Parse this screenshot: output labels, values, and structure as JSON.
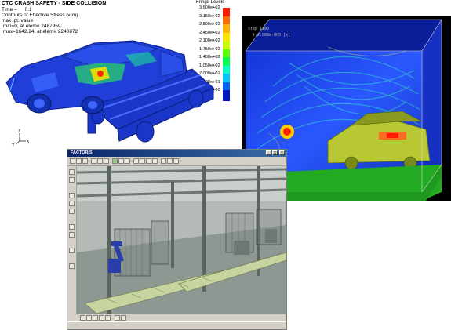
{
  "crash": {
    "title": "CTC CRASH SAFETY - SIDE COLLISION",
    "time_label": "Time =",
    "time_value": "0.1",
    "contour_label": "Contours of Effective Stress (v-m)",
    "max_ipt": "max ipt. value",
    "min_line": "min=0, at elem# 2487959",
    "max_line": "max=1642.24, at elem# 2240872",
    "fringe_title": "Fringe Levels",
    "axis_z": "Z",
    "axis_y": "Y",
    "axis_x": "X",
    "fringe_levels": [
      {
        "label": "3.500e+02",
        "color": "#ff1a00"
      },
      {
        "label": "3.150e+02",
        "color": "#ff6a00"
      },
      {
        "label": "2.800e+02",
        "color": "#ffb400"
      },
      {
        "label": "2.450e+02",
        "color": "#ffe600"
      },
      {
        "label": "2.100e+02",
        "color": "#c8ff00"
      },
      {
        "label": "1.750e+02",
        "color": "#5aff00"
      },
      {
        "label": "1.400e+02",
        "color": "#00ff50"
      },
      {
        "label": "1.050e+02",
        "color": "#00ffc0"
      },
      {
        "label": "7.000e+01",
        "color": "#00c8ff"
      },
      {
        "label": "3.500e+01",
        "color": "#0064ff"
      },
      {
        "label": "0.000e+00",
        "color": "#0014c8"
      }
    ]
  },
  "sim": {
    "step_label": "Step 1180",
    "time_label": "t 2.888e-005 [s]"
  },
  "factory": {
    "window_title": "FACTORIS",
    "minimize": "_",
    "maximize": "□",
    "close": "×"
  },
  "colors": {
    "car_blue": "#1f3fd8",
    "sim_bg": "#000000",
    "sim_floor": "#22aa22",
    "win_chrome": "#d4d0c8",
    "titlebar": "#0a246a"
  }
}
